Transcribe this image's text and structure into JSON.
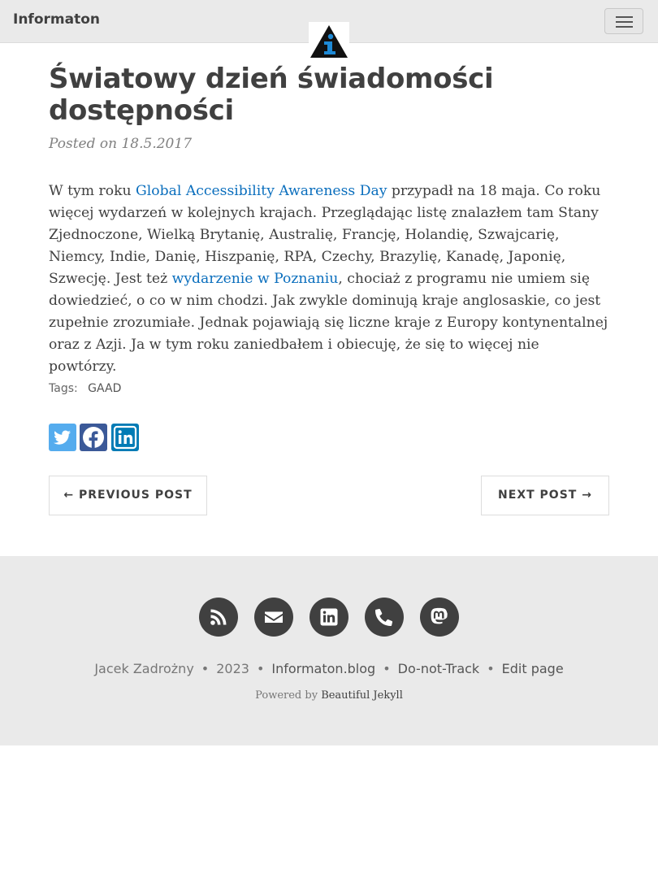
{
  "navbar": {
    "brand": "Informaton",
    "toggler_icon": "hamburger-icon",
    "logo_icon": "info-triangle-logo"
  },
  "post": {
    "title_line1": "Światowy dzień świadomości",
    "title_line2": "dostępności",
    "posted_prefix": "Posted on",
    "date": "18.5.2017",
    "body": {
      "p1": "W tym roku ",
      "link1": "Global Accessibility Awareness Day",
      "p2": " przypadł na 18 maja. Co roku więcej wydarzeń w kolejnych krajach. Przeglądając listę znalazłem tam Stany Zjednoczone, Wielką Brytanię, Australię, Francję, Holandię, Szwajcarię, Niemcy, Indie, Danię, Hiszpanię, RPA, Czechy, Brazylię, Kanadę, Japonię, Szwecję. Jest też ",
      "link2": "wydarzenie w Poznaniu",
      "p3": ", chociaż z programu nie umiem się dowiedzieć, o co w nim chodzi. Jak zwykle dominują kraje anglosaskie, co jest zupełnie zrozumiałe. Jednak pojawiają się liczne kraje z Europy kontynentalnej oraz z Azji. Ja w tym roku zaniedbałem i obiecuję, że się to więcej nie powtórzy."
    },
    "tags_label": "Tags:",
    "tags": [
      "GAAD"
    ],
    "share": [
      {
        "icon": "twitter-icon",
        "color": "#55acee"
      },
      {
        "icon": "facebook-icon",
        "color": "#3b5998"
      },
      {
        "icon": "linkedin-icon",
        "color": "#007bb5"
      }
    ]
  },
  "pager": {
    "previous": "← PREVIOUS POST",
    "next": "NEXT POST →"
  },
  "footer": {
    "social_icons": [
      "rss-icon",
      "envelope-icon",
      "linkedin-icon",
      "phone-icon",
      "mastodon-icon"
    ],
    "author": "Jacek Zadrożny",
    "year": "2023",
    "site": "Informaton.blog",
    "dnt": "Do-not-Track",
    "edit": "Edit page",
    "powered_prefix": "Powered by",
    "powered_link": "Beautiful Jekyll",
    "separator": "•"
  },
  "colors": {
    "link": "#0a6ebd",
    "navbar_bg": "#eaeaea",
    "footer_bg": "#eaeaea",
    "social_bg": "#404040",
    "logo_blue": "#1e8ad6"
  }
}
